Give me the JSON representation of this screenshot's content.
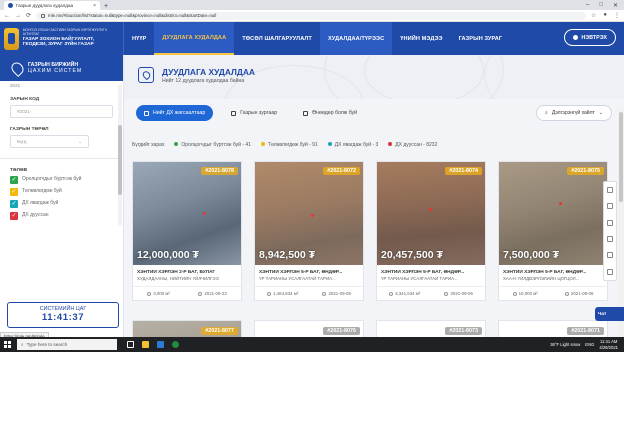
{
  "browser": {
    "tab_title": "Газрын дуудлага худалдаа",
    "url": "mle.mn/#/auction/list?status=null&type=null&province=null&district=null&startDate=null",
    "nav_back": "←",
    "nav_forward": "→",
    "nav_reload": "⟳",
    "tab_close": "×",
    "new_tab": "+"
  },
  "header": {
    "org_line": "МОНГОЛ УЛСЫН ЗАСГИЙН ГАЗРЫН ХЭРЭГЖҮҮЛЭГЧ АГЕНТЛАГ",
    "org_name_1": "ГАЗАР ЗОХИОН БАЙГУУЛАЛТ,",
    "org_name_2": "ГЕОДЕЗИ, ЗУРАГ ЗҮЙН ГАЗАР",
    "nav": [
      {
        "label": "НҮҮР"
      },
      {
        "label": "ДУУДЛАГА ХУДАЛДАА"
      },
      {
        "label": "ТӨСӨЛ ШАЛГАРУУЛАЛТ"
      },
      {
        "label": "ХУДАЛДАА/ТҮРЭЭС"
      },
      {
        "label": "ҮНИЙН МЭДЭЭ"
      },
      {
        "label": "ГАЗРЫН ЗУРАГ"
      }
    ],
    "login_label": "НЭВТРЭХ"
  },
  "sidebar": {
    "system_title": "ГАЗРЫН БИРЖИЙН",
    "system_subtitle": "ЦАХИМ СИСТЕМ",
    "year_value": "2021",
    "code_label": "ЗАРЫН КОД",
    "code_placeholder": "#2021-",
    "type_label": "ГАЗРЫН ТӨРӨЛ",
    "type_value": "Бүгд",
    "status_label": "ТӨЛӨВ",
    "statuses": [
      {
        "label": "Оролцогчдыг бүртгэж буй",
        "color": "#2ea44f"
      },
      {
        "label": "Төлөвлөгдөж буй",
        "color": "#f0b90b"
      },
      {
        "label": "ДХ явагдаж буй",
        "color": "#16a6b6"
      },
      {
        "label": "ДХ дууссан",
        "color": "#d9363e"
      }
    ],
    "clock_title": "СИСТЕМИЙН ЦАГ",
    "clock_value": "11:41:37",
    "status_url": "https://mle.mn/#/sale"
  },
  "main": {
    "title": "ДУУДЛАГА ХУДАЛДАА",
    "subtitle": "Нийт 12 дуудлага худалдаа байна",
    "views": [
      {
        "label": "Нийт ДХ жагсаалтаар"
      },
      {
        "label": "Газрын зургаар"
      },
      {
        "label": "Өнөөдөр болж буй"
      }
    ],
    "sort_label": "Дэлгэрэнгүй хайлт",
    "legend": [
      {
        "label": "Бүгдийг харах"
      },
      {
        "label": "Оролцогчдыг бүртгэж буй - 41",
        "color": "#2ea44f"
      },
      {
        "label": "Төлөвлөгдөж буй - 91",
        "color": "#f0b90b"
      },
      {
        "label": "ДХ явагдаж буй - 3",
        "color": "#16a6b6"
      },
      {
        "label": "ДХ дууссан - 8232",
        "color": "#d9363e"
      }
    ],
    "cards": [
      {
        "code": "#2021-8078",
        "price": "12,000,000 ₮",
        "title": "ХЭНТИЙ ХЭРЛЭН 2-Р БАГ, БУЛАГ",
        "subtitle": "ХУДАЛДААНЫ, НИЙТИЙН ҮЙЛЧИЛГЭЭ",
        "area": "3,000 м²",
        "date": "2021-09-23"
      },
      {
        "code": "#2021-8072",
        "price": "8,942,500 ₮",
        "title": "ХЭНТИЙ ХЭРЛЭН 5-Р БАГ, ӨНДӨР...",
        "subtitle": "ҮР ТАРИАНЫ УСАЛГААТАЙ ТАРИА...",
        "area": "1,464,834 м²",
        "date": "2021-09-06"
      },
      {
        "code": "#2021-8074",
        "price": "20,457,500 ₮",
        "title": "ХЭНТИЙ ХЭРЛЭН 5-Р БАГ, ӨНДӨР...",
        "subtitle": "ҮР ТАРИАНЫ УСАЛГААТАЙ ТАРИА...",
        "area": "3,341,634 м²",
        "date": "2021-09-06"
      },
      {
        "code": "#2021-8075",
        "price": "7,500,000 ₮",
        "title": "ХЭНТИЙ ХЭРЛЭН 5-Р БАГ, ӨНДӨР...",
        "subtitle": "ХАА-Н ҮЙЛДВЭРЛЭЛИЙН ЦОГЦОЛ...",
        "area": "10,000 м²",
        "date": "2021-09-06"
      }
    ],
    "cards_row2": [
      {
        "code": "#2021-8077"
      },
      {
        "code": "#2021-8076"
      },
      {
        "code": "#2021-8073"
      },
      {
        "code": "#2021-8071"
      }
    ],
    "floating_label": "Чат"
  },
  "taskbar": {
    "search_placeholder": "Type here to search",
    "weather": "36°F  Light snow",
    "lang": "ENG",
    "time": "11:41 AM",
    "date": "4/29/2021"
  },
  "colors": {
    "brand": "#1f4aa8",
    "accent": "#f6c544",
    "active_pill": "#1f66d6"
  }
}
